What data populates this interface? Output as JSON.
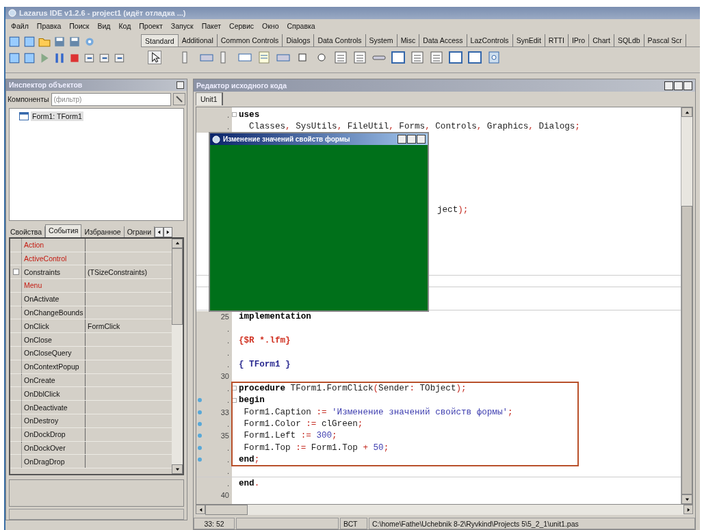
{
  "window": {
    "title": "Lazarus IDE v1.2.6 - project1 (идёт отладка ...)"
  },
  "menu": [
    "Файл",
    "Правка",
    "Поиск",
    "Вид",
    "Код",
    "Проект",
    "Запуск",
    "Пакет",
    "Сервис",
    "Окно",
    "Справка"
  ],
  "palette_tabs": [
    {
      "label": "Standard",
      "selected": true
    },
    {
      "label": "Additional",
      "selected": false
    },
    {
      "label": "Common Controls",
      "selected": false
    },
    {
      "label": "Dialogs",
      "selected": false
    },
    {
      "label": "Data Controls",
      "selected": false
    },
    {
      "label": "System",
      "selected": false
    },
    {
      "label": "Misc",
      "selected": false
    },
    {
      "label": "Data Access",
      "selected": false
    },
    {
      "label": "LazControls",
      "selected": false
    },
    {
      "label": "SynEdit",
      "selected": false
    },
    {
      "label": "RTTI",
      "selected": false
    },
    {
      "label": "IPro",
      "selected": false
    },
    {
      "label": "Chart",
      "selected": false
    },
    {
      "label": "SQLdb",
      "selected": false
    },
    {
      "label": "Pascal Scr",
      "selected": false
    }
  ],
  "inspector": {
    "title": "Инспектор объектов",
    "filter_label": "Компоненты",
    "filter_placeholder": "(фильтр)",
    "tree": [
      {
        "label": "Form1: TForm1",
        "selected": true
      }
    ],
    "tabs": [
      {
        "label": "Свойства",
        "selected": false
      },
      {
        "label": "События",
        "selected": true
      },
      {
        "label": "Избранное",
        "selected": false
      },
      {
        "label": "Ограни",
        "selected": false
      }
    ],
    "rows": [
      {
        "name": "Action",
        "highlighted": true
      },
      {
        "name": "ActiveControl",
        "highlighted": true
      },
      {
        "name": "Constraints",
        "value": "(TSizeConstraints)",
        "highlighted": false,
        "expandable": true
      },
      {
        "name": "Menu",
        "highlighted": true
      },
      {
        "name": "OnActivate",
        "highlighted": false
      },
      {
        "name": "OnChangeBounds",
        "highlighted": false
      },
      {
        "name": "OnClick",
        "value": "FormClick",
        "highlighted": false
      },
      {
        "name": "OnClose",
        "highlighted": false
      },
      {
        "name": "OnCloseQuery",
        "highlighted": false
      },
      {
        "name": "OnContextPopup",
        "highlighted": false
      },
      {
        "name": "OnCreate",
        "highlighted": false
      },
      {
        "name": "OnDblClick",
        "highlighted": false
      },
      {
        "name": "OnDeactivate",
        "highlighted": false
      },
      {
        "name": "OnDestroy",
        "highlighted": false
      },
      {
        "name": "OnDockDrop",
        "highlighted": false
      },
      {
        "name": "OnDockOver",
        "highlighted": false
      },
      {
        "name": "OnDragDrop",
        "highlighted": false
      }
    ]
  },
  "editor": {
    "title": "Редактор исходного кода",
    "tabs": [
      {
        "label": "Unit1",
        "selected": true
      }
    ],
    "sections": [
      {
        "kind": "plain",
        "lines": [
          {
            "gutter": ".",
            "fold": true,
            "tokens": [
              {
                "kind": "keyword",
                "text": "uses"
              }
            ]
          },
          {
            "gutter": ".",
            "tokens": [
              {
                "kind": "plain",
                "text": "  Classes"
              },
              {
                "kind": "symbol",
                "text": ","
              },
              {
                "kind": "plain",
                "text": " SysUtils"
              },
              {
                "kind": "symbol",
                "text": ","
              },
              {
                "kind": "plain",
                "text": " FileUtil"
              },
              {
                "kind": "symbol",
                "text": ","
              },
              {
                "kind": "plain",
                "text": " Forms"
              },
              {
                "kind": "symbol",
                "text": ","
              },
              {
                "kind": "plain",
                "text": " Controls"
              },
              {
                "kind": "symbol",
                "text": ","
              },
              {
                "kind": "plain",
                "text": " Graphics"
              },
              {
                "kind": "symbol",
                "text": ","
              },
              {
                "kind": "plain",
                "text": " Dialogs"
              },
              {
                "kind": "symbol",
                "text": ";"
              }
            ]
          }
        ]
      },
      {
        "kind": "covered",
        "lines": [
          {
            "tokens": [
              {
                "kind": "plain",
                "text": "ject"
              },
              {
                "kind": "symbol",
                "text": ");"
              }
            ]
          }
        ]
      },
      {
        "kind": "plain",
        "lines": [
          {
            "gutter": "25",
            "tokens": [
              {
                "kind": "keyword",
                "text": "implementation"
              }
            ]
          },
          {
            "gutter": "."
          },
          {
            "gutter": ".",
            "tokens": [
              {
                "kind": "directive",
                "text": "{$R *.lfm}"
              }
            ]
          },
          {
            "gutter": "."
          },
          {
            "gutter": ".",
            "tokens": [
              {
                "kind": "comment",
                "text": "{ TForm1 }"
              }
            ]
          },
          {
            "gutter": "30"
          }
        ]
      },
      {
        "kind": "framed",
        "lines": [
          {
            "gutter": ".",
            "fold": true,
            "tokens": [
              {
                "kind": "keyword",
                "text": "procedure"
              },
              {
                "kind": "plain",
                "text": " TForm1.FormClick"
              },
              {
                "kind": "symbol",
                "text": "("
              },
              {
                "kind": "plain",
                "text": "Sender"
              },
              {
                "kind": "symbol",
                "text": ":"
              },
              {
                "kind": "plain",
                "text": " TObject"
              },
              {
                "kind": "symbol",
                "text": ");"
              }
            ]
          },
          {
            "gutter": ".",
            "dot": true,
            "fold": true,
            "tokens": [
              {
                "kind": "keyword",
                "text": "begin"
              }
            ]
          },
          {
            "gutter": "33",
            "dot": true,
            "tokens": [
              {
                "kind": "plain",
                "text": " Form1.Caption "
              },
              {
                "kind": "symbol",
                "text": ":="
              },
              {
                "kind": "string",
                "text": " 'Изменение значений свойств формы'"
              },
              {
                "kind": "symbol",
                "text": ";"
              }
            ]
          },
          {
            "gutter": ".",
            "dot": true,
            "tokens": [
              {
                "kind": "plain",
                "text": " Form1.Color "
              },
              {
                "kind": "symbol",
                "text": ":="
              },
              {
                "kind": "plain",
                "text": " clGreen"
              },
              {
                "kind": "symbol",
                "text": ";"
              }
            ]
          },
          {
            "gutter": "35",
            "dot": true,
            "tokens": [
              {
                "kind": "plain",
                "text": " Form1.Left "
              },
              {
                "kind": "symbol",
                "text": ":="
              },
              {
                "kind": "number",
                "text": " 300"
              },
              {
                "kind": "symbol",
                "text": ";"
              }
            ]
          },
          {
            "gutter": ".",
            "dot": true,
            "tokens": [
              {
                "kind": "plain",
                "text": " Form1.Top "
              },
              {
                "kind": "symbol",
                "text": ":="
              },
              {
                "kind": "plain",
                "text": " Form1.Top "
              },
              {
                "kind": "symbol",
                "text": "+"
              },
              {
                "kind": "number",
                "text": " 50"
              },
              {
                "kind": "symbol",
                "text": ";"
              }
            ]
          },
          {
            "gutter": ".",
            "dot": true,
            "rule_below": true,
            "tokens": [
              {
                "kind": "keyword",
                "text": "end"
              },
              {
                "kind": "symbol",
                "text": ";"
              }
            ]
          }
        ]
      },
      {
        "kind": "plain",
        "lines": [
          {
            "gutter": ".",
            "rule_below": true
          },
          {
            "gutter": ".",
            "tokens": [
              {
                "kind": "keyword",
                "text": "end"
              },
              {
                "kind": "symbol",
                "text": "."
              }
            ]
          },
          {
            "gutter": "40"
          }
        ]
      }
    ]
  },
  "form_window": {
    "title": "Изменение значений свойств формы",
    "color": "#00701a"
  },
  "status_bar": {
    "position": "33: 52",
    "mode": "ВСТ",
    "path": "C:\\home\\Fathe\\Uchebnik 8-2\\Ryvkind\\Projects 5\\5_2_1\\unit1.pas"
  }
}
